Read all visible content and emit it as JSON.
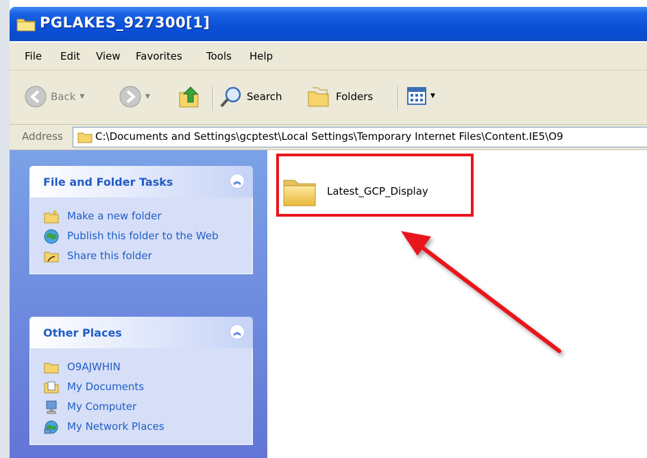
{
  "window": {
    "title": "PGLAKES_927300[1]"
  },
  "menu": [
    "File",
    "Edit",
    "View",
    "Favorites",
    "Tools",
    "Help"
  ],
  "toolbar": {
    "back": "Back",
    "search": "Search",
    "folders": "Folders"
  },
  "address": {
    "label": "Address",
    "value": "C:\\Documents and Settings\\gcptest\\Local Settings\\Temporary Internet Files\\Content.IE5\\O9"
  },
  "tasks": {
    "title": "File and Folder Tasks",
    "items": [
      "Make a new folder",
      "Publish this folder to the Web",
      "Share this folder"
    ]
  },
  "places": {
    "title": "Other Places",
    "items": [
      "O9AJWHIN",
      "My Documents",
      "My Computer",
      "My Network Places"
    ]
  },
  "content": {
    "folder_name": "Latest_GCP_Display"
  },
  "colors": {
    "highlight": "#e8141b",
    "arrow": "#e8141b",
    "link": "#215dc6"
  }
}
